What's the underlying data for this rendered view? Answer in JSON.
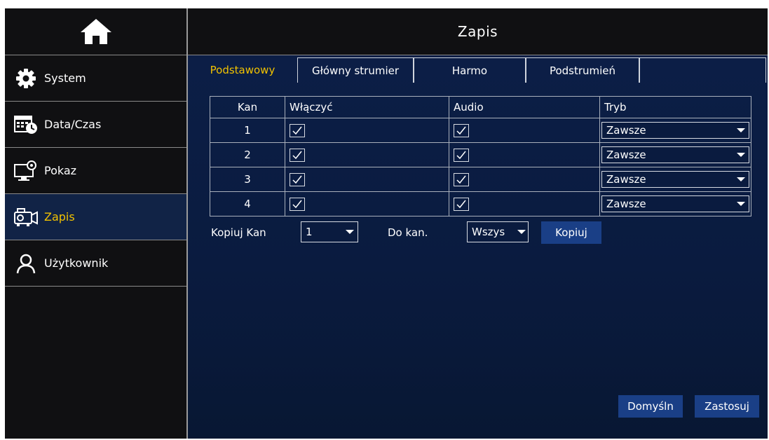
{
  "header": {
    "title": "Zapis"
  },
  "sidebar": {
    "items": [
      {
        "label": "System",
        "icon": "gear-icon"
      },
      {
        "label": "Data/Czas",
        "icon": "calendar-clock-icon"
      },
      {
        "label": "Pokaz",
        "icon": "monitor-gear-icon"
      },
      {
        "label": "Zapis",
        "icon": "camera-record-icon",
        "active": true
      },
      {
        "label": "Użytkownik",
        "icon": "user-icon"
      }
    ]
  },
  "tabs": [
    {
      "label": "Podstawowy",
      "active": true
    },
    {
      "label": "Główny strumier"
    },
    {
      "label": "Harmo"
    },
    {
      "label": "Podstrumień"
    }
  ],
  "table": {
    "headers": {
      "kan": "Kan",
      "wlaczyc": "Włączyć",
      "audio": "Audio",
      "tryb": "Tryb"
    },
    "rows": [
      {
        "kan": "1",
        "enabled": true,
        "audio": true,
        "tryb": "Zawsze"
      },
      {
        "kan": "2",
        "enabled": true,
        "audio": true,
        "tryb": "Zawsze"
      },
      {
        "kan": "3",
        "enabled": true,
        "audio": true,
        "tryb": "Zawsze"
      },
      {
        "kan": "4",
        "enabled": true,
        "audio": true,
        "tryb": "Zawsze"
      }
    ]
  },
  "copy": {
    "from_label": "Kopiuj Kan",
    "from_value": "1",
    "to_label": "Do kan.",
    "to_value": "Wszys",
    "button": "Kopiuj"
  },
  "footer": {
    "default_button": "Domyśln",
    "apply_button": "Zastosuj"
  },
  "colors": {
    "accent": "#f2c200",
    "panel": "#0c1f48",
    "button": "#1a3f86",
    "active_item": "#112346"
  }
}
